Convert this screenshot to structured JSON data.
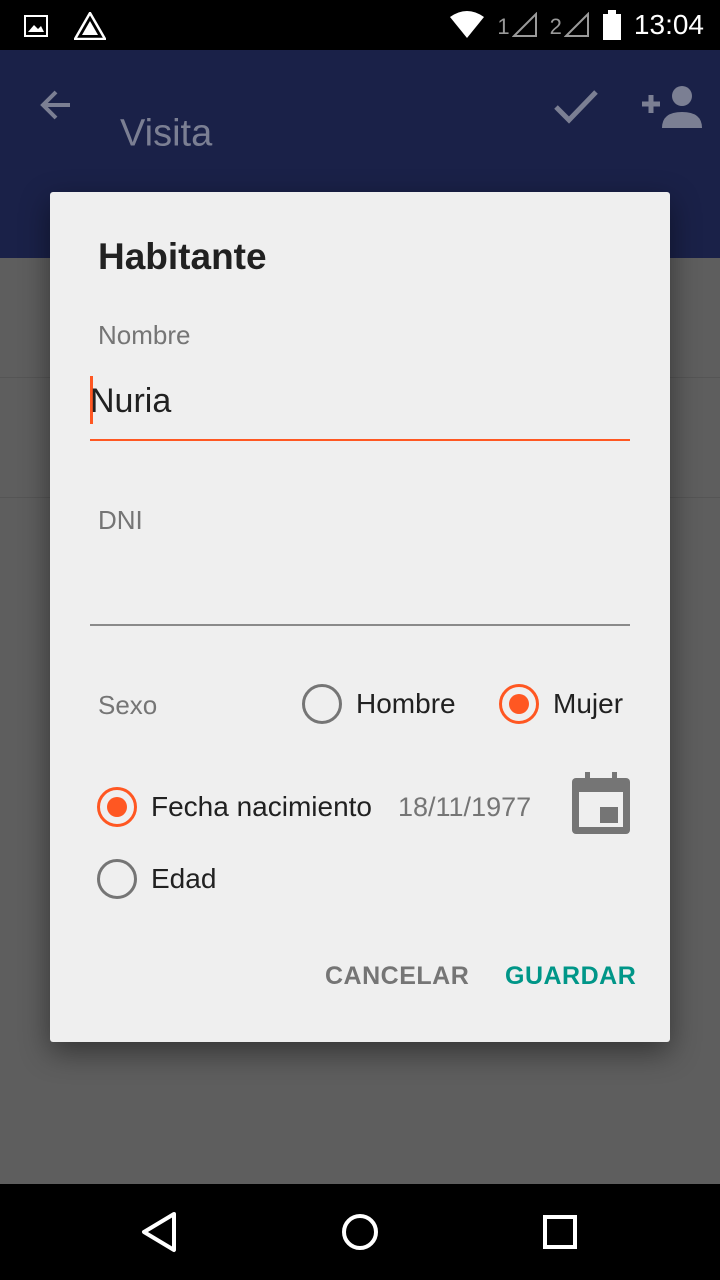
{
  "status_bar": {
    "icons_left": [
      "image-icon",
      "app-logo-icon"
    ],
    "sim1": "1",
    "sim2": "2",
    "time": "13:04"
  },
  "app_bar": {
    "title": "Visita",
    "back_icon": "arrow-left-icon",
    "confirm_icon": "check-icon",
    "add_icon": "add-person-icon"
  },
  "dialog": {
    "title": "Habitante",
    "nombre": {
      "label": "Nombre",
      "value": "Nuria"
    },
    "dni": {
      "label": "DNI",
      "value": ""
    },
    "sexo": {
      "label": "Sexo",
      "options": [
        {
          "label": "Hombre",
          "checked": false
        },
        {
          "label": "Mujer",
          "checked": true
        }
      ]
    },
    "fecha": {
      "option_label": "Fecha nacimiento",
      "checked": true,
      "value": "18/11/1977"
    },
    "edad": {
      "option_label": "Edad",
      "checked": false
    },
    "buttons": {
      "cancel": "CANCELAR",
      "save": "GUARDAR"
    }
  },
  "colors": {
    "accent": "#ff5722",
    "teal": "#009688",
    "appbar": "#1a2148"
  }
}
